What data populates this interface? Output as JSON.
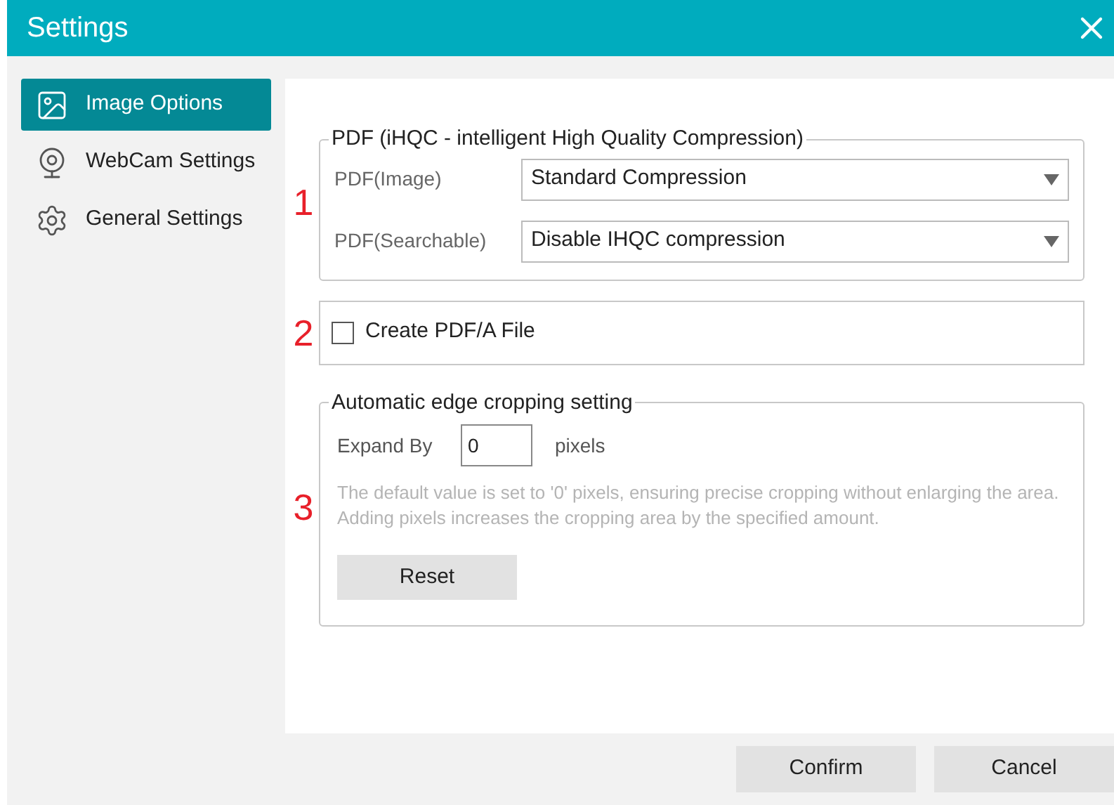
{
  "window": {
    "title": "Settings"
  },
  "sidebar": {
    "items": [
      {
        "label": "Image Options",
        "selected": true
      },
      {
        "label": "WebCam Settings",
        "selected": false
      },
      {
        "label": "General Settings",
        "selected": false
      }
    ]
  },
  "pdf_group": {
    "title": "PDF (iHQC - intelligent High Quality Compression)",
    "marker": "1",
    "rows": [
      {
        "label": "PDF(Image)",
        "value": "Standard Compression"
      },
      {
        "label": "PDF(Searchable)",
        "value": "Disable IHQC compression"
      }
    ]
  },
  "pdfa_group": {
    "marker": "2",
    "label": "Create PDF/A File",
    "checked": false
  },
  "crop_group": {
    "title": "Automatic edge cropping setting",
    "marker": "3",
    "label": "Expand By",
    "value": "0",
    "unit": "pixels",
    "note": "The default value is set to '0' pixels, ensuring precise cropping without enlarging the area. Adding pixels increases the cropping area by the specified amount.",
    "button": "Reset"
  },
  "buttons": [
    "Confirm",
    "Cancel"
  ]
}
